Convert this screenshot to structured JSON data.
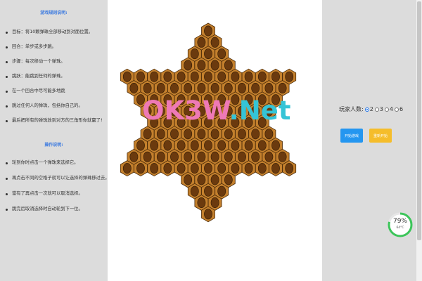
{
  "rules": {
    "title": "游戏规则说明:",
    "items": [
      "目标：将10颗弹珠全部移动到对面位置。",
      "回合：单步或多步跳。",
      "步骤：每次移动一个弹珠。",
      "跳跃：能跳到任何的弹珠。",
      "在一个回合中尽可能多地跳",
      "跳过任何人的弹珠，包括你自己的。",
      "最后把所有的弹珠放到对方的三角形你就赢了!"
    ]
  },
  "operations": {
    "title": "操作说明:",
    "items": [
      "轮到你时点击一个弹珠来选择它。",
      "再点击不同的空格子就可以让选择的弹珠移过去。",
      "當有了再点击一次就可以取消选择。",
      "跳完后取消选择时自动轮到下一位。"
    ]
  },
  "players": {
    "label": "玩家人数:",
    "options": [
      "2",
      "3",
      "4",
      "6"
    ],
    "selected": "2"
  },
  "buttons": {
    "start": "开始游戏",
    "restart": "重新开始"
  },
  "watermark": {
    "part1": "OK3W",
    "part2": ".Net"
  },
  "gauge": {
    "percent": "79%",
    "sub": "64°C",
    "value": 0.79,
    "color": "#3cc55a"
  },
  "board": {
    "hole_color": "#6b3a0e",
    "tile_color": "#c4802d",
    "edge_color": "#4a2a08"
  }
}
